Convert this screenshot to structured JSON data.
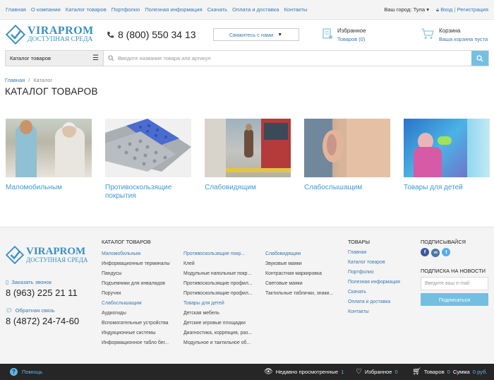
{
  "topnav": [
    "Главная",
    "О компании",
    "Каталог товаров",
    "Портфолио",
    "Полезная информация",
    "Скачать",
    "Оплата и доставка",
    "Контакты"
  ],
  "city": {
    "label": "Ваш город:",
    "value": "Тула",
    "login": "Вход",
    "separator": "|",
    "register": "Регистрация"
  },
  "logo": {
    "line1": "VIRAPROM",
    "line2": "ДОСТУПНАЯ СРЕДА"
  },
  "phone": "8 (800) 550 34 13",
  "contact_button": "Свяжитесь с нами",
  "favorites": {
    "title": "Избранное",
    "sub": "Товаров (0)"
  },
  "cart": {
    "title": "Корзина",
    "sub": "Ваша корзина пуста"
  },
  "catalog_button": "Каталог товаров",
  "search": {
    "placeholder": "Введите название товара или артикул"
  },
  "breadcrumb": {
    "home": "Главная",
    "sep": "/",
    "current": "Каталог"
  },
  "page_title": "КАТАЛОГ ТОВАРОВ",
  "categories": [
    {
      "label": "Маломобильным"
    },
    {
      "label": "Противоскользящие покрытия"
    },
    {
      "label": "Слабовидящим"
    },
    {
      "label": "Слабослышащим"
    },
    {
      "label": "Товары для детей"
    }
  ],
  "footer": {
    "call_link": "Заказать звонок",
    "call_phone": "8 (963) 225 21 11",
    "feedback_link": "Обратная связь",
    "feedback_phone": "8 (4872) 24-74-60",
    "catalog_heading": "КАТАЛОГ ТОВАРОВ",
    "col1": {
      "h1": "Маломобильным",
      "items1": [
        "Информационные терминалы",
        "Пандусы",
        "Подъемники для инвалидов",
        "Поручни"
      ],
      "h2": "Слабослышащим",
      "items2": [
        "Аудиогиды",
        "Вспомогательные устройства",
        "Индукционные системы",
        "Информационное табло бег..."
      ]
    },
    "col2": {
      "h1": "Противоскользящие покр...",
      "items1": [
        "Клей",
        "Модульные напольные покр...",
        "Противоскользящие профил...",
        "Противоскользящие профил..."
      ],
      "h2": "Товары для детей",
      "items2": [
        "Детская мебель",
        "Детские игровые площадки",
        "Диагностика, коррекция, раз...",
        "Модульное и тактильное об..."
      ]
    },
    "col3": {
      "h1": "Слабовидящим",
      "items1": [
        "Звуковые маяки",
        "Контрастная маркировка",
        "Световые маяки",
        "Тактильные таблички, знаки..."
      ]
    },
    "goods_heading": "ТОВАРЫ",
    "goods_links": [
      "Главная",
      "Каталог товаров",
      "Портфолио",
      "Полезная информация",
      "Скачать",
      "Оплата и доставка",
      "Контакты"
    ],
    "follow_heading": "ПОДПИСЫВАЙСЯ",
    "social": [
      "f",
      "vk",
      "t"
    ],
    "news_heading": "ПОДПИСКА НА НОВОСТИ",
    "email_placeholder": "Введите ваш e-mail",
    "subscribe_button": "Подписаться"
  },
  "bottombar": {
    "help": "Помощь",
    "recent_label": "Недавно просмотренные",
    "recent_count": "1",
    "fav_label": "Избранное",
    "fav_count": "0",
    "cart_label": "Товаров",
    "cart_count": "0",
    "sum_label": "Сумма",
    "sum_value": "0 руб."
  },
  "colors": {
    "accent": "#3d9bd1",
    "search_button": "#75c0e0",
    "bottom_bar": "#262626"
  }
}
